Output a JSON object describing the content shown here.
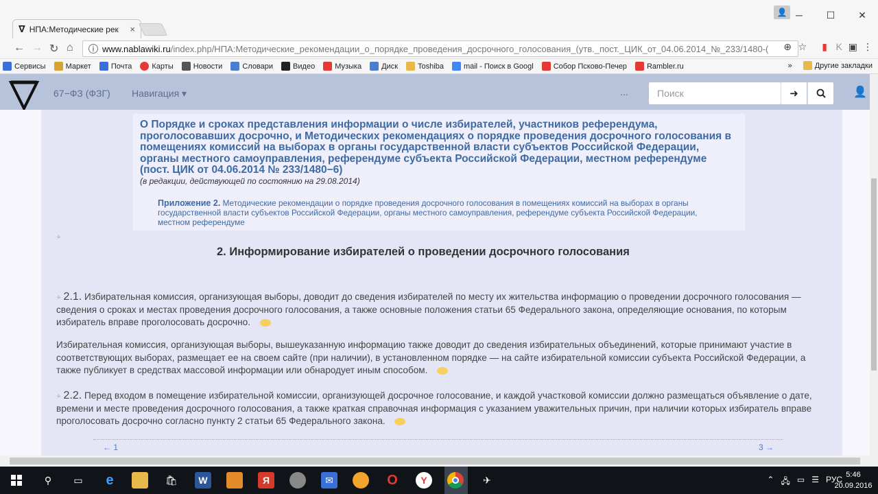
{
  "browser": {
    "tab_title": "НПА:Методические рек",
    "tab_favicon": "∇",
    "tab_close": "×",
    "url_domain": "www.nablawiki.ru",
    "url_path": "/index.php/НПА:Методические_рекомендации_о_порядке_проведения_досрочного_голосования_(утв._пост._ЦИК_от_04.06.2014_№_233/1480-(",
    "window_controls": {
      "minimize": "─",
      "maximize": "☐",
      "close": "✕"
    }
  },
  "bookmarks": [
    {
      "label": "Сервисы",
      "color": "#3a6fd8"
    },
    {
      "label": "Маркет",
      "color": "#d8a431"
    },
    {
      "label": "Почта",
      "color": "#3a6fd8"
    },
    {
      "label": "Карты",
      "color": "#e53935"
    },
    {
      "label": "Новости",
      "color": "#555555"
    },
    {
      "label": "Словари",
      "color": "#4a7fd0"
    },
    {
      "label": "Видео",
      "color": "#222222"
    },
    {
      "label": "Музыка",
      "color": "#e53935"
    },
    {
      "label": "Диск",
      "color": "#4a7fd0"
    },
    {
      "label": "Toshiba",
      "color": "#e8b94a"
    },
    {
      "label": "mail - Поиск в Googl",
      "color": "#4285f4"
    },
    {
      "label": "Собор Псково-Печер",
      "color": "#e53935"
    },
    {
      "label": "Rambler.ru",
      "color": "#e53935"
    }
  ],
  "bookmarks_more": "»",
  "bookmarks_other": "Другие закладки",
  "site": {
    "nav_link_1": "67−ФЗ (ФЗГ)",
    "nav_link_2": "Навигация ▾",
    "ellipsis": "...",
    "search_placeholder": "Поиск",
    "go_icon": "➜",
    "search_icon": "🔍"
  },
  "doc": {
    "title": "О Порядке и сроках представления информации о числе избирателей, участников референдума, проголосовавших досрочно, и Методических рекомендациях о порядке проведения досрочного голосования в помещениях комиссий на выборах в органы государственной власти субъектов Российской Федерации, органы местного самоуправления, референдуме субъекта Российской Федерации, местном референдуме (пост. ЦИК от 04.06.2014 № 233/1480−6)",
    "subtitle": "(в редакции, действующей по состоянию на 29.08.2014)",
    "appendix_label": "Приложение 2.",
    "appendix_text": "Методические рекомендации о порядке проведения досрочного голосования в помещениях комиссий на выборах в органы государственной власти субъектов Российской Федерации, органы местного самоуправления, референдуме субъекта Российской Федерации, местном референдуме",
    "section_title": "2. Информирование избирателей о проведении досрочного голосования",
    "p1_num": "2.1.",
    "p1_text": "Избирательная комиссия, организующая выборы, доводит до сведения избирателей по месту их жительства информацию о проведении досрочного голосования — сведения о сроках и местах проведения досрочного голосования, а также основные положения статьи 65 Федерального закона, определяющие основания, по которым избиратель вправе проголосовать досрочно.",
    "p2_text": "Избирательная комиссия, организующая выборы, вышеуказанную информацию также доводит до сведения избирательных объединений, которые принимают участие в соответствующих выборах, размещает ее на своем сайте (при наличии), в установленном порядке — на сайте избирательной комиссии субъекта Российской Федерации, а также публикует в средствах массовой информации или обнародует иным способом.",
    "p3_num": "2.2.",
    "p3_text": "Перед входом в помещение избирательной комиссии, организующей досрочное голосование, и каждой участковой комиссии должно размещаться объявление о дате, времени и месте проведения досрочного голосования, а также краткая справочная информация с указанием уважительных причин, при наличии которых избиратель вправе проголосовать досрочно согласно пункту 2 статьи 65 Федерального закона.",
    "pager_prev": "← 1",
    "pager_next": "3 →"
  },
  "taskbar": {
    "lang": "РУС",
    "time": "5:46",
    "date": "20.09.2016"
  }
}
